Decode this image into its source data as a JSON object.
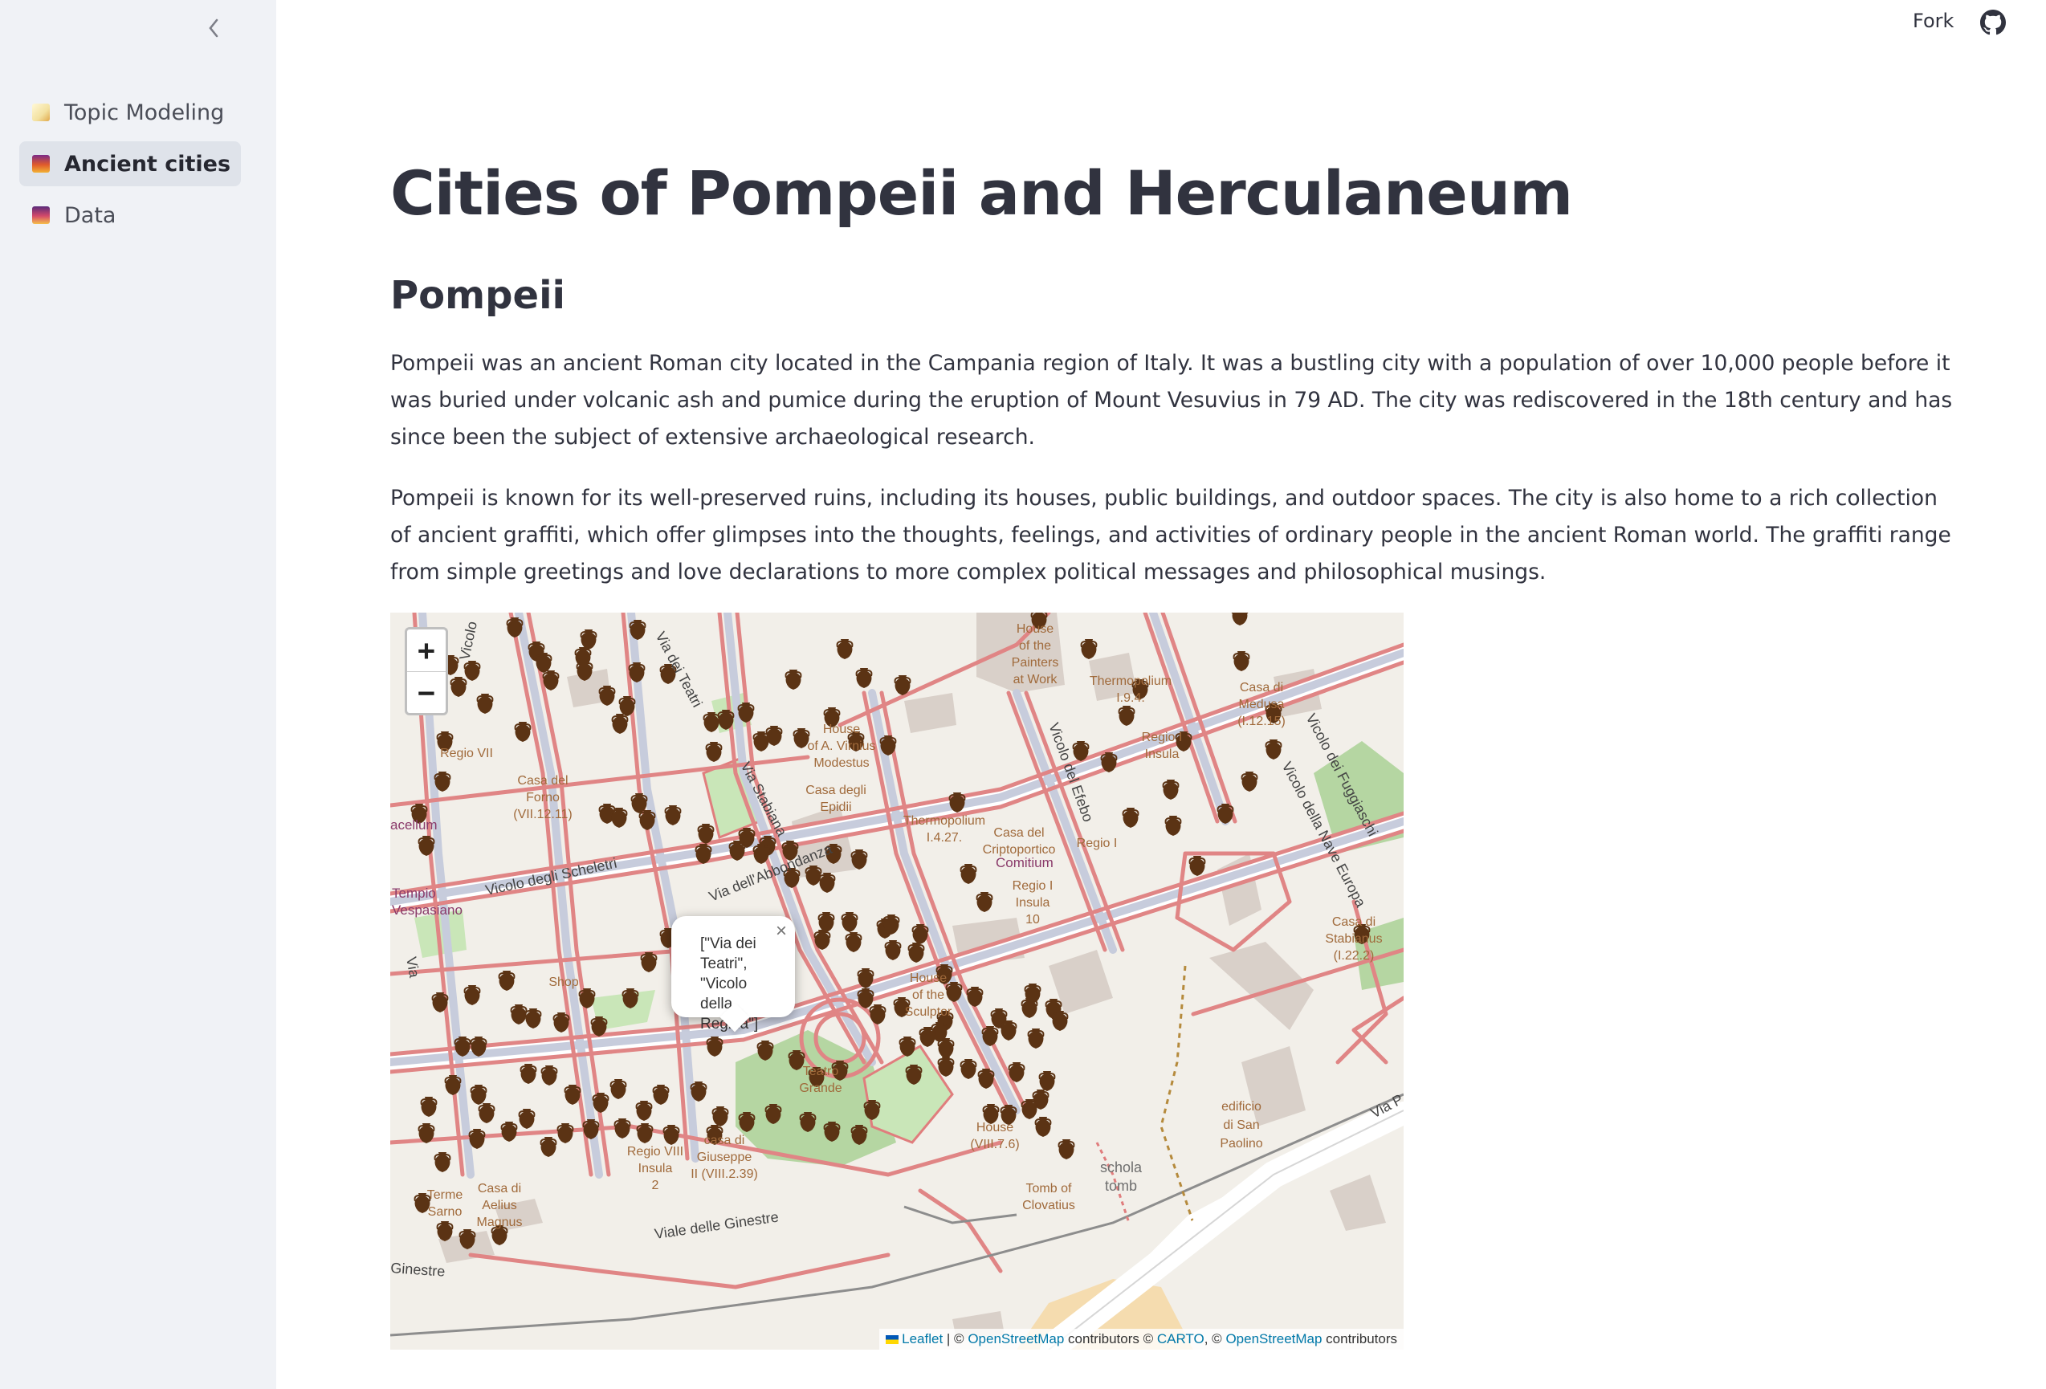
{
  "sidebar": {
    "items": [
      {
        "label": "Topic Modeling",
        "emoji": "memo-icon",
        "color": "#e6c34a"
      },
      {
        "label": "Ancient cities",
        "emoji": "cityscape-dusk-icon",
        "color": "#c0392b"
      },
      {
        "label": "Data",
        "emoji": "sunrise-icon",
        "color": "#8e3b7a"
      }
    ],
    "active_index": 1
  },
  "header": {
    "fork_label": "Fork"
  },
  "main": {
    "title": "Cities of Pompeii and Herculaneum",
    "section": "Pompeii",
    "paragraph1": "Pompeii was an ancient Roman city located in the Campania region of Italy. It was a bustling city with a population of over 10,000 people before it was buried under volcanic ash and pumice during the eruption of Mount Vesuvius in 79 AD. The city was rediscovered in the 18th century and has since been the subject of extensive archaeological research.",
    "paragraph2": "Pompeii is known for its well-preserved ruins, including its houses, public buildings, and outdoor spaces. The city is also home to a rich collection of ancient graffiti, which offer glimpses into the thoughts, feelings, and activities of ordinary people in the ancient Roman world. The graffiti range from simple greetings and love declarations to more complex political messages and philosophical musings."
  },
  "map": {
    "zoom_in": "+",
    "zoom_out": "−",
    "popup_lines": [
      "[\"Via dei",
      "Teatri\",",
      "\"Vicolo",
      "della",
      "Regina\"]"
    ],
    "popup_close": "×",
    "attribution": {
      "leaflet": "Leaflet",
      "sep1": " | © ",
      "osm1": "OpenStreetMap",
      "mid": " contributors © ",
      "carto": "CARTO",
      "sep2": ", © ",
      "osm2": "OpenStreetMap",
      "end": " contributors"
    },
    "labels": {
      "house_painters": [
        "House",
        "of the",
        "Painters",
        "at Work"
      ],
      "thermopolium_194": [
        "Thermopolium",
        "I.9.4."
      ],
      "casa_medusa": [
        "Casa di",
        "Medusa",
        "(I.12.15)"
      ],
      "vicolo_fuggiaschi": "Vicolo dei Fuggiaschi",
      "house_virnius": [
        "House",
        "of A. Virnius",
        "Modestus"
      ],
      "casa_epidii": [
        "Casa degli",
        "Epidii"
      ],
      "vicolo_efebo": "Vicolo del Efebo",
      "regio_i_insula": [
        "Regio I",
        "Insula"
      ],
      "casa_forno": [
        "Casa del",
        "Forno",
        "(VII.12.11)"
      ],
      "macellum": "acellum",
      "regio_vii": "Regio VII",
      "thermopolium_1427": [
        "Thermopolium",
        "I.4.27."
      ],
      "casa_criptoportico": [
        "Casa del",
        "Criptoportico"
      ],
      "regio_i": "Regio I",
      "vicolo_scheletri": "Vicolo degli Scheletri",
      "via_abbondanza": "Via dell'Abbondanza",
      "via_stabiana": "Via Stabiana",
      "comitium": "Comitium",
      "vicolo_nave_europa": "Vicolo della Nave Europa",
      "tempio_vespasiano": [
        "Tempio",
        "Vespasiano"
      ],
      "regio_i_insula_10": [
        "Regio I",
        "Insula",
        "10"
      ],
      "casa_stabianus": [
        "Casa di",
        "Stabianus",
        "(I.22.2)"
      ],
      "shop": "Shop",
      "house_sculptor": [
        "House",
        "of the",
        "Sculptor"
      ],
      "teatro_grande": [
        "Teatro",
        "Grande"
      ],
      "house_viii76": [
        "House",
        "(VIII.7.6)"
      ],
      "schola_tomb": [
        "schola",
        "tomb"
      ],
      "edificio_san_paolino": [
        "edificio",
        "di San",
        "Paolino"
      ],
      "via_p": "Via P",
      "regio_viii_insula_2": [
        "Regio VIII",
        "Insula",
        "2"
      ],
      "casa_giuseppe": [
        "casa di",
        "Giuseppe",
        "II (VIII.2.39)"
      ],
      "terme_sarno": [
        "Terme",
        "Sarno"
      ],
      "casa_aelius": [
        "Casa di",
        "Aelius",
        "Magnus"
      ],
      "tomb_clovatius": [
        "Tomb of",
        "Clovatius"
      ],
      "viale_ginestre": "Viale delle Ginestre",
      "ginestre": "Ginestre",
      "vicolo_left": "Vicolo",
      "via_teatri": "Via dei Teatri",
      "via_left": "Via"
    }
  }
}
